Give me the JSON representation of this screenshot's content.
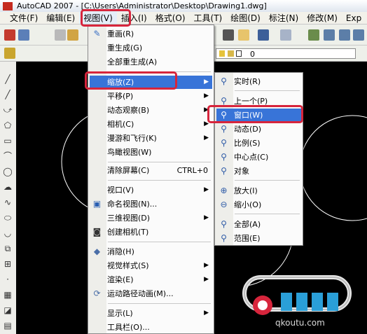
{
  "window": {
    "title": "AutoCAD 2007 - [C:\\Users\\Administrator\\Desktop\\Drawing1.dwg]"
  },
  "menubar": [
    "文件(F)",
    "编辑(E)",
    "视图(V)",
    "插入(I)",
    "格式(O)",
    "工具(T)",
    "绘图(D)",
    "标注(N)",
    "修改(M)",
    "Exp"
  ],
  "layer": {
    "value": "0"
  },
  "view_menu": {
    "items": [
      {
        "label": "重画(R)",
        "icon": "pen-icon"
      },
      {
        "label": "重生成(G)"
      },
      {
        "label": "全部重生成(A)"
      },
      {
        "label": "缩放(Z)",
        "submenu": true,
        "highlighted": true
      },
      {
        "label": "平移(P)",
        "submenu": true
      },
      {
        "label": "动态观察(B)",
        "submenu": true
      },
      {
        "label": "相机(C)",
        "submenu": true
      },
      {
        "label": "漫游和飞行(K)",
        "submenu": true
      },
      {
        "label": "鸟瞰视图(W)"
      },
      {
        "label": "清除屏幕(C)",
        "shortcut": "CTRL+0"
      },
      {
        "label": "视口(V)",
        "submenu": true
      },
      {
        "label": "命名视图(N)...",
        "icon": "named-view-icon"
      },
      {
        "label": "三维视图(D)",
        "submenu": true
      },
      {
        "label": "创建相机(T)",
        "icon": "camera-icon"
      },
      {
        "label": "消隐(H)",
        "icon": "hide-icon"
      },
      {
        "label": "视觉样式(S)",
        "submenu": true
      },
      {
        "label": "渲染(E)",
        "submenu": true
      },
      {
        "label": "运动路径动画(M)...",
        "icon": "motion-path-icon"
      },
      {
        "label": "显示(L)",
        "submenu": true
      },
      {
        "label": "工具栏(O)..."
      }
    ]
  },
  "zoom_menu": {
    "items": [
      {
        "label": "实时(R)",
        "icon": "zoom-realtime-icon"
      },
      {
        "label": "上一个(P)",
        "icon": "zoom-previous-icon"
      },
      {
        "label": "窗口(W)",
        "icon": "zoom-window-icon",
        "highlighted": true
      },
      {
        "label": "动态(D)",
        "icon": "zoom-dynamic-icon"
      },
      {
        "label": "比例(S)",
        "icon": "zoom-scale-icon"
      },
      {
        "label": "中心点(C)",
        "icon": "zoom-center-icon"
      },
      {
        "label": "对象",
        "icon": "zoom-object-icon"
      },
      {
        "label": "放大(I)",
        "icon": "zoom-in-icon"
      },
      {
        "label": "缩小(O)",
        "icon": "zoom-out-icon"
      },
      {
        "label": "全部(A)",
        "icon": "zoom-all-icon"
      },
      {
        "label": "范围(E)",
        "icon": "zoom-extents-icon"
      }
    ]
  },
  "watermark": {
    "url": "qkoutu.com"
  },
  "colors": {
    "highlight": "#3874d8",
    "annotation": "#d7253c"
  }
}
